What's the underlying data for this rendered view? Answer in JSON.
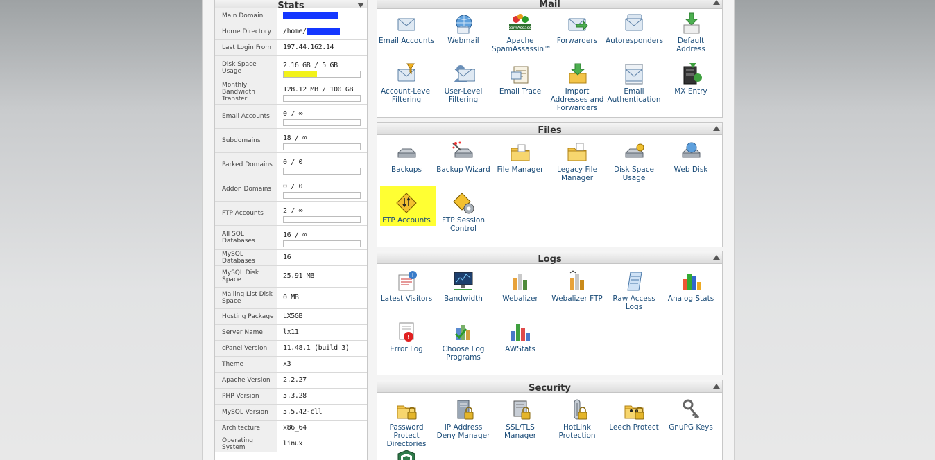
{
  "stats": {
    "title": "Stats",
    "rows": [
      {
        "label": "Main Domain",
        "value": ""
      },
      {
        "label": "Home Directory",
        "value": "/home/"
      },
      {
        "label": "Last Login From",
        "value": "197.44.162.14"
      },
      {
        "label": "Disk Space Usage",
        "value": "2.16 GB / 5 GB",
        "usage": 0.432
      },
      {
        "label": "Monthly Bandwidth Transfer",
        "value": "128.12 MB / 100 GB",
        "usage": 0.0013
      },
      {
        "label": "Email Accounts",
        "value": "0 / ∞",
        "usage": 0
      },
      {
        "label": "Subdomains",
        "value": "18 / ∞",
        "usage": 0
      },
      {
        "label": "Parked Domains",
        "value": "0 / 0",
        "usage": 0
      },
      {
        "label": "Addon Domains",
        "value": "0 / 0",
        "usage": 0
      },
      {
        "label": "FTP Accounts",
        "value": "2 / ∞",
        "usage": 0
      },
      {
        "label": "All SQL Databases",
        "value": "16 / ∞",
        "usage": 0
      },
      {
        "label": "MySQL Databases",
        "value": "16"
      },
      {
        "label": "MySQL Disk Space",
        "value": "25.91 MB"
      },
      {
        "label": "Mailing List Disk Space",
        "value": "0 MB"
      },
      {
        "label": "Hosting Package",
        "value": "LX5GB"
      },
      {
        "label": "Server Name",
        "value": "lx11"
      },
      {
        "label": "cPanel Version",
        "value": "11.48.1 (build 3)"
      },
      {
        "label": "Theme",
        "value": "x3"
      },
      {
        "label": "Apache Version",
        "value": "2.2.27"
      },
      {
        "label": "PHP Version",
        "value": "5.3.28"
      },
      {
        "label": "MySQL Version",
        "value": "5.5.42-cll"
      },
      {
        "label": "Architecture",
        "value": "x86_64"
      },
      {
        "label": "Operating System",
        "value": "linux"
      }
    ]
  },
  "sections": {
    "mail": {
      "title": "Mail",
      "items": [
        "Email Accounts",
        "Webmail",
        "Apache SpamAssassin™",
        "Forwarders",
        "Autoresponders",
        "Default Address",
        "Account-Level Filtering",
        "User-Level Filtering",
        "Email Trace",
        "Import Addresses and Forwarders",
        "Email Authentication",
        "MX Entry"
      ],
      "icons": [
        "envelope-icon",
        "webmail-globe-icon",
        "spamassassin-icon",
        "forwarders-icon",
        "autoresponders-icon",
        "default-address-icon",
        "account-filter-icon",
        "user-filter-icon",
        "email-trace-icon",
        "import-icon",
        "email-auth-icon",
        "mx-entry-icon"
      ],
      "spamassassin_logo": "SpamAssassin"
    },
    "files": {
      "title": "Files",
      "items": [
        "Backups",
        "Backup Wizard",
        "File Manager",
        "Legacy File Manager",
        "Disk Space Usage",
        "Web Disk",
        "FTP Accounts",
        "FTP Session Control"
      ],
      "icons": [
        "backup-drive-icon",
        "backup-wizard-icon",
        "file-manager-icon",
        "legacy-file-manager-icon",
        "disk-space-icon",
        "web-disk-icon",
        "ftp-accounts-icon",
        "ftp-session-icon"
      ]
    },
    "logs": {
      "title": "Logs",
      "items": [
        "Latest Visitors",
        "Bandwidth",
        "Webalizer",
        "Webalizer FTP",
        "Raw Access Logs",
        "Analog Stats",
        "Error Log",
        "Choose Log Programs",
        "AWStats"
      ],
      "icons": [
        "latest-visitors-icon",
        "bandwidth-icon",
        "webalizer-icon",
        "webalizer-ftp-icon",
        "raw-access-logs-icon",
        "analog-stats-icon",
        "error-log-icon",
        "choose-log-programs-icon",
        "awstats-icon"
      ]
    },
    "security": {
      "title": "Security",
      "items": [
        "Password Protect Directories",
        "IP Address Deny Manager",
        "SSL/TLS Manager",
        "HotLink Protection",
        "Leech Protect",
        "GnuPG Keys"
      ],
      "icons": [
        "password-protect-icon",
        "ip-deny-icon",
        "ssl-tls-icon",
        "hotlink-icon",
        "leech-protect-icon",
        "gnupg-keys-icon",
        "shield-icon"
      ]
    }
  },
  "highlight_color": "#ffff33",
  "link_color": "#1b4c78"
}
